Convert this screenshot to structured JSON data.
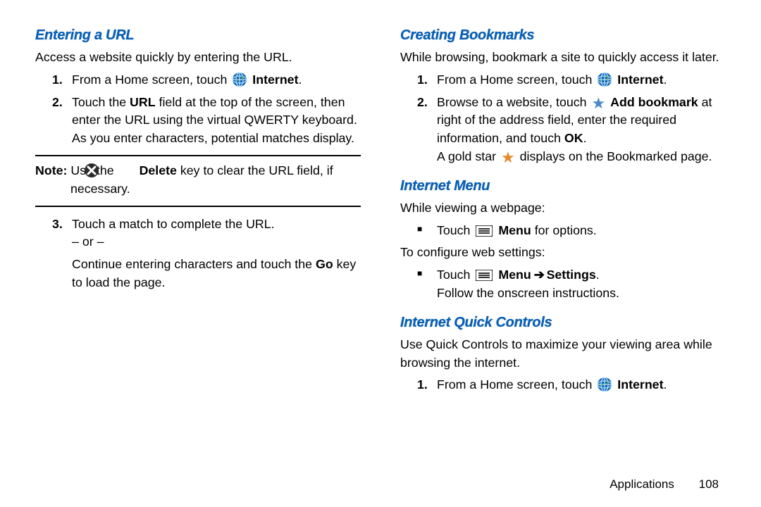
{
  "left": {
    "h1": "Entering a URL",
    "intro": "Access a website quickly by entering the URL.",
    "li1_num": "1.",
    "li1_a": "From a Home screen, touch",
    "li1_b": "Internet",
    "li1_c": ".",
    "li2_num": "2.",
    "li2_a": "Touch the ",
    "li2_b": "URL",
    "li2_c": " field at the top of the screen, then enter the URL using the virtual QWERTY keyboard.",
    "li2_d": "As you enter characters, potential matches display.",
    "note_a": "Note:",
    "note_b": " Use the ",
    "note_c": "Delete",
    "note_d": " key to clear the URL field, if necessary.",
    "li3_num": "3.",
    "li3_a": "Touch a match to complete the URL.",
    "li3_or": "– or –",
    "li3_b": "Continue entering characters and touch the ",
    "li3_c": "Go",
    "li3_d": " key to load the page."
  },
  "right": {
    "h1": "Creating Bookmarks",
    "intro": "While browsing, bookmark a site to quickly access it later.",
    "li1_num": "1.",
    "li1_a": "From a Home screen, touch",
    "li1_b": "Internet",
    "li1_c": ".",
    "li2_num": "2.",
    "li2_a": "Browse to a website, touch ",
    "li2_b": "Add bookmark",
    "li2_c": " at right of the address field, enter the required information, and touch ",
    "li2_d": "OK",
    "li2_e": ".",
    "li2_f": "A gold star ",
    "li2_g": " displays on the Bookmarked page.",
    "h2": "Internet Menu",
    "im_intro": "While viewing a webpage:",
    "im_b1_a": "Touch ",
    "im_b1_b": "Menu",
    "im_b1_c": " for options.",
    "im_conf": "To configure web settings:",
    "im_b2_a": "Touch ",
    "im_b2_b": "Menu",
    "im_b2_arrow": " ➔ ",
    "im_b2_c": "Settings",
    "im_b2_d": ".",
    "im_b2_e": "Follow the onscreen instructions.",
    "h3": "Internet Quick Controls",
    "iq_intro": "Use Quick Controls to maximize your viewing area while browsing the internet.",
    "iq_li1_num": "1.",
    "iq_li1_a": "From a Home screen, touch",
    "iq_li1_b": "Internet",
    "iq_li1_c": "."
  },
  "footer": {
    "section": "Applications",
    "page": "108"
  }
}
